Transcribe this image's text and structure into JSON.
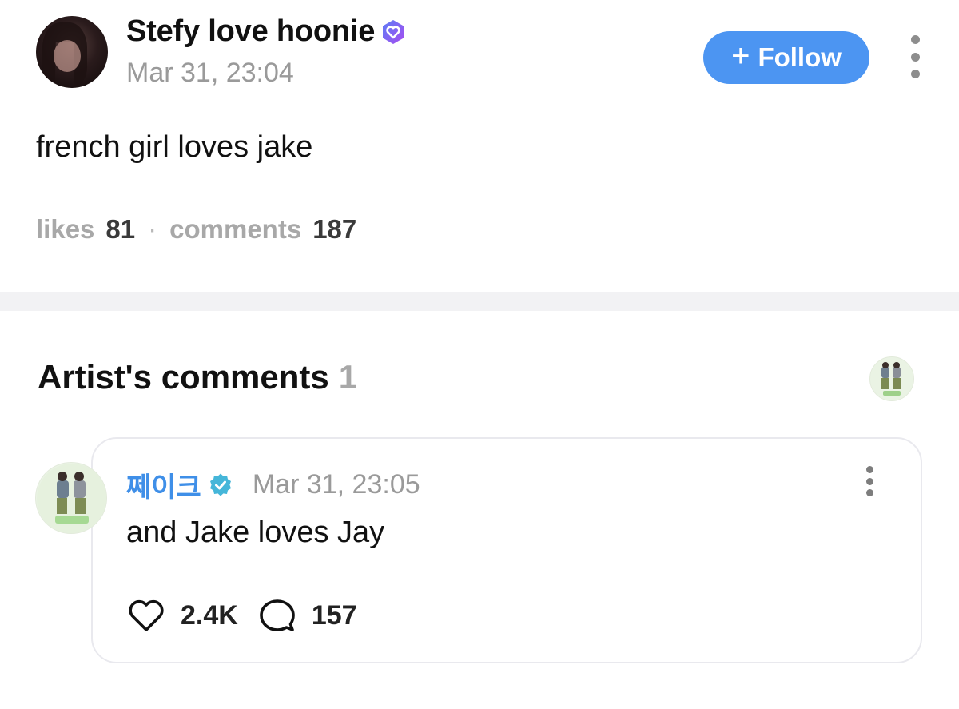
{
  "post": {
    "author": "Stefy love hoonie",
    "time": "Mar 31, 23:04",
    "follow_label": "Follow",
    "body": "french girl loves jake",
    "likes_label": "likes",
    "likes_count": "81",
    "comments_label": "comments",
    "comments_count": "187",
    "separator": "·"
  },
  "artist_comments": {
    "title": "Artist's comments",
    "count": "1",
    "comment": {
      "author": "쩨이크",
      "time": "Mar 31, 23:05",
      "body": "and Jake loves Jay",
      "likes": "2.4K",
      "replies": "157"
    }
  },
  "icons": {
    "follow": "plus-icon",
    "fan_badge": "verified-heart-badge-icon",
    "artist_badge": "verified-check-badge-icon",
    "like": "heart-icon",
    "reply": "speech-bubble-icon",
    "more": "vertical-ellipsis-icon"
  },
  "colors": {
    "accent": "#4c95f2",
    "artist_name": "#3f8fe8",
    "fan_badge": "#8a5cf0",
    "artist_badge": "#45b6d9"
  }
}
